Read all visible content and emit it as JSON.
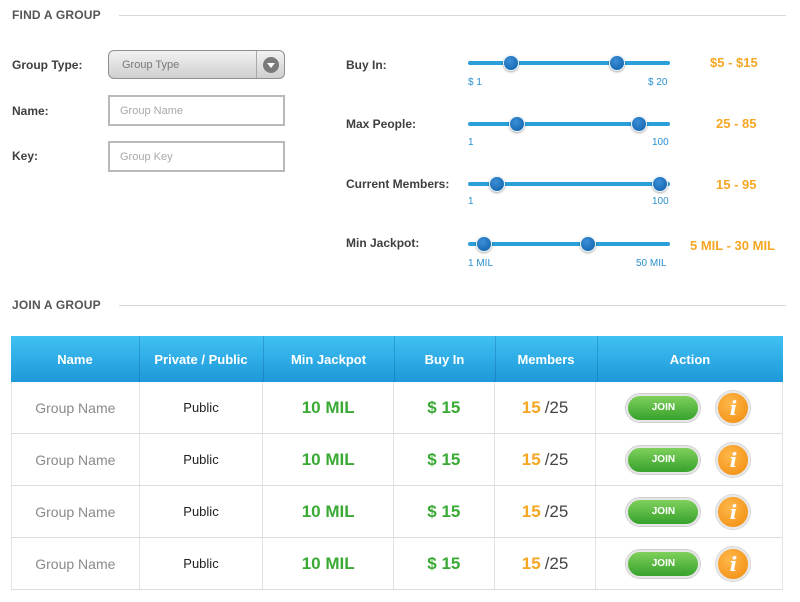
{
  "find": {
    "title": "FIND A GROUP",
    "group_type_label": "Group Type:",
    "group_type_value": "Group Type",
    "name_label": "Name:",
    "name_placeholder": "Group Name",
    "key_label": "Key:",
    "key_placeholder": "Group Key",
    "sliders": [
      {
        "label": "Buy In:",
        "min_label": "$ 1",
        "max_label": "$ 20",
        "min": 1,
        "max": 20,
        "low": 5,
        "high": 15,
        "range_text": "$5 - $15"
      },
      {
        "label": "Max People:",
        "min_label": "1",
        "max_label": "100",
        "min": 1,
        "max": 100,
        "low": 25,
        "high": 85,
        "range_text": "25 - 85"
      },
      {
        "label": "Current Members:",
        "min_label": "1",
        "max_label": "100",
        "min": 1,
        "max": 100,
        "low": 15,
        "high": 95,
        "range_text": "15 - 95"
      },
      {
        "label": "Min Jackpot:",
        "min_label": "1 MIL",
        "max_label": "50 MIL",
        "min": 1,
        "max": 50,
        "low": 5,
        "high": 30,
        "range_text": "5 MIL - 30 MIL"
      }
    ]
  },
  "join": {
    "title": "JOIN A GROUP",
    "columns": [
      "Name",
      "Private / Public",
      "Min Jackpot",
      "Buy In",
      "Members",
      "Action"
    ],
    "rows": [
      {
        "name": "Group Name",
        "privacy": "Public",
        "jackpot": "10 MIL",
        "buyin": "$ 15",
        "members_current": "15",
        "members_total": "/25",
        "join_label": "JOIN",
        "info_label": "i"
      },
      {
        "name": "Group Name",
        "privacy": "Public",
        "jackpot": "10 MIL",
        "buyin": "$ 15",
        "members_current": "15",
        "members_total": "/25",
        "join_label": "JOIN",
        "info_label": "i"
      },
      {
        "name": "Group Name",
        "privacy": "Public",
        "jackpot": "10 MIL",
        "buyin": "$ 15",
        "members_current": "15",
        "members_total": "/25",
        "join_label": "JOIN",
        "info_label": "i"
      },
      {
        "name": "Group Name",
        "privacy": "Public",
        "jackpot": "10 MIL",
        "buyin": "$ 15",
        "members_current": "15",
        "members_total": "/25",
        "join_label": "JOIN",
        "info_label": "i"
      }
    ]
  },
  "colors": {
    "accent_blue": "#2a9fd8",
    "range_orange": "#f5a623",
    "value_green": "#3aaa35",
    "join_green": "#36a22c"
  },
  "icons": {
    "dropdown": "chevron-down-icon",
    "info": "info-icon",
    "slider_knob": "slider-handle"
  }
}
